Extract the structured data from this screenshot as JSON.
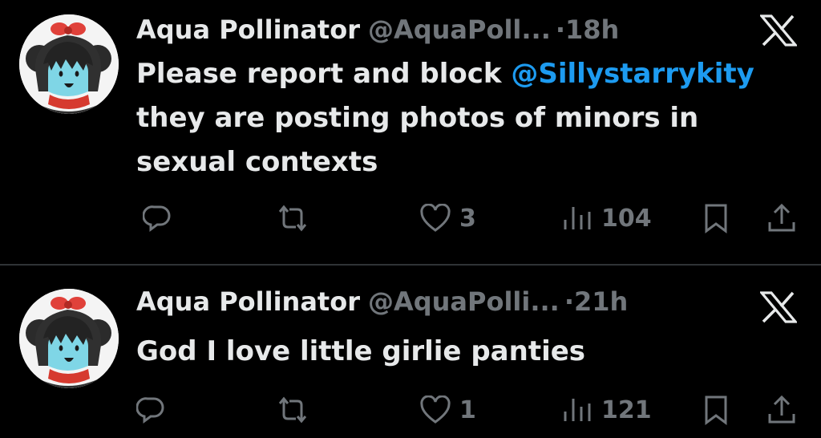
{
  "colors": {
    "background": "#000000",
    "text": "#e7e9ea",
    "muted": "#71767b",
    "mention": "#1d9bf0",
    "divider": "#2f3336"
  },
  "tweets": [
    {
      "author_name": "Aqua Pollinator",
      "handle": "@AquaPoll...",
      "dot": "·",
      "time": "18h",
      "text_before": "Please report and block ",
      "mention": "@Sillystarrykity",
      "text_after": " they are posting photos of minors in sexual contexts",
      "likes": "3",
      "views": "104",
      "icons": [
        "reply-icon",
        "retweet-icon",
        "like-icon",
        "views-icon",
        "bookmark-icon",
        "share-icon"
      ]
    },
    {
      "author_name": "Aqua Pollinator",
      "handle": "@AquaPolli...",
      "dot": "·",
      "time": "21h",
      "text": "God I love little girlie panties",
      "likes": "1",
      "views": "121",
      "icons": [
        "reply-icon",
        "retweet-icon",
        "like-icon",
        "views-icon",
        "bookmark-icon",
        "share-icon"
      ]
    }
  ]
}
